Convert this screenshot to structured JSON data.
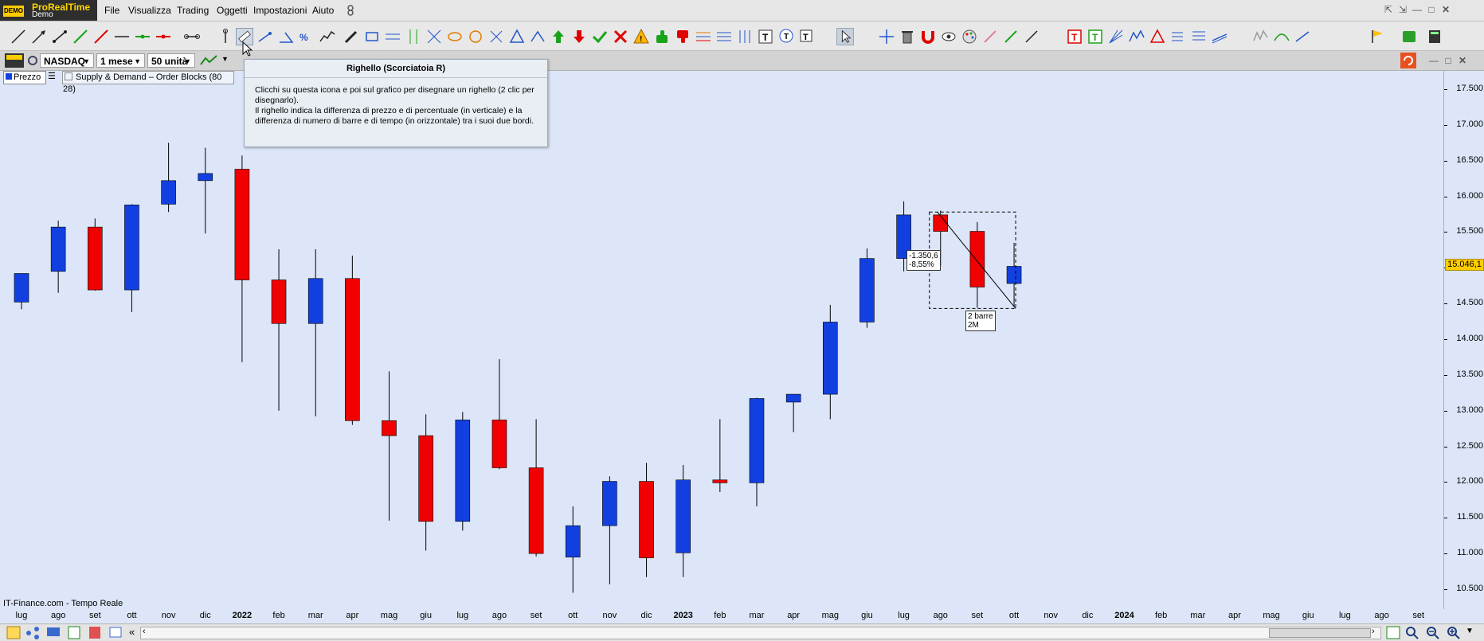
{
  "app": {
    "name": "ProRealTime",
    "badge": "DEMO",
    "sub": "Demo",
    "menu": [
      "File",
      "Visualizza",
      "Trading",
      "Oggetti",
      "Impostazioni",
      "Aiuto"
    ]
  },
  "chart_header": {
    "instrument": "NASDAQ",
    "timeframe": "1 mese",
    "units": "50 unità",
    "legend_price": "Prezzo",
    "legend_indicator": "Supply & Demand – Order Blocks (80 28)",
    "source": "IT-Finance.com - Tempo Reale"
  },
  "tooltip": {
    "title": "Righello (Scorciatoia R)",
    "line1": "Clicchi su questa icona e poi sul grafico per disegnare un righello (2 clic per disegnarlo).",
    "line2": "Il righello indica la differenza di prezzo e di percentuale (in verticale) e la differenza di numero di barre e di tempo (in orizzontale) tra i suoi due bordi."
  },
  "ruler": {
    "price_diff": "-1.350,6",
    "pct_diff": "-8,55%",
    "bars": "2 barre",
    "time": "2M"
  },
  "last_price_label": "15.046,1",
  "colors": {
    "up": "#1240e0",
    "down": "#f00000",
    "bg": "#dce6f8",
    "last_price": "#ffcc00"
  },
  "chart_data": {
    "type": "candlestick",
    "ylim": [
      10300,
      17700
    ],
    "y_ticks": [
      10500,
      11000,
      11500,
      12000,
      12500,
      13000,
      13500,
      14000,
      14500,
      15000,
      15500,
      16000,
      16500,
      17000,
      17500
    ],
    "y_tick_labels": [
      "10.500",
      "11.000",
      "11.500",
      "12.000",
      "12.500",
      "13.000",
      "13.500",
      "14.000",
      "14.500",
      "15.000",
      "15.500",
      "16.000",
      "16.500",
      "17.000",
      "17.500"
    ],
    "x_labels": [
      "lug",
      "ago",
      "set",
      "ott",
      "nov",
      "dic",
      "2022",
      "feb",
      "mar",
      "apr",
      "mag",
      "giu",
      "lug",
      "ago",
      "set",
      "ott",
      "nov",
      "dic",
      "2023",
      "feb",
      "mar",
      "apr",
      "mag",
      "giu",
      "lug",
      "ago",
      "set",
      "ott",
      "nov",
      "dic",
      "2024",
      "feb",
      "mar",
      "apr",
      "mag",
      "giu",
      "lug",
      "ago",
      "set"
    ],
    "candles": [
      {
        "o": 14520,
        "h": 14900,
        "l": 14420,
        "c": 14920
      },
      {
        "o": 14950,
        "h": 15660,
        "l": 14650,
        "c": 15570
      },
      {
        "o": 15570,
        "h": 15690,
        "l": 14680,
        "c": 14690
      },
      {
        "o": 14690,
        "h": 15890,
        "l": 14380,
        "c": 15880
      },
      {
        "o": 15890,
        "h": 16750,
        "l": 15780,
        "c": 16220
      },
      {
        "o": 16220,
        "h": 16680,
        "l": 15480,
        "c": 16320
      },
      {
        "o": 16380,
        "h": 16570,
        "l": 13680,
        "c": 14830
      },
      {
        "o": 14830,
        "h": 15260,
        "l": 13000,
        "c": 14220
      },
      {
        "o": 14220,
        "h": 15260,
        "l": 12920,
        "c": 14850
      },
      {
        "o": 14850,
        "h": 15170,
        "l": 12800,
        "c": 12860
      },
      {
        "o": 12860,
        "h": 13550,
        "l": 11460,
        "c": 12650
      },
      {
        "o": 12650,
        "h": 12950,
        "l": 11040,
        "c": 11450
      },
      {
        "o": 11450,
        "h": 12980,
        "l": 11320,
        "c": 12870
      },
      {
        "o": 12870,
        "h": 13720,
        "l": 12180,
        "c": 12200
      },
      {
        "o": 12200,
        "h": 12880,
        "l": 10960,
        "c": 11000
      },
      {
        "o": 10950,
        "h": 11660,
        "l": 10450,
        "c": 11390
      },
      {
        "o": 11390,
        "h": 12080,
        "l": 10570,
        "c": 12010
      },
      {
        "o": 12010,
        "h": 12270,
        "l": 10670,
        "c": 10940
      },
      {
        "o": 11010,
        "h": 12240,
        "l": 10670,
        "c": 12030
      },
      {
        "o": 12030,
        "h": 12880,
        "l": 11860,
        "c": 11990
      },
      {
        "o": 11990,
        "h": 13180,
        "l": 11660,
        "c": 13170
      },
      {
        "o": 13120,
        "h": 13220,
        "l": 12700,
        "c": 13230
      },
      {
        "o": 13230,
        "h": 14480,
        "l": 12880,
        "c": 14240
      },
      {
        "o": 14240,
        "h": 15270,
        "l": 14160,
        "c": 15130
      },
      {
        "o": 15130,
        "h": 15930,
        "l": 14950,
        "c": 15740
      },
      {
        "o": 15740,
        "h": 15800,
        "l": 15030,
        "c": 15510
      },
      {
        "o": 15510,
        "h": 15640,
        "l": 14440,
        "c": 14730
      },
      {
        "o": 14780,
        "h": 15350,
        "l": 14450,
        "c": 15020
      }
    ]
  }
}
